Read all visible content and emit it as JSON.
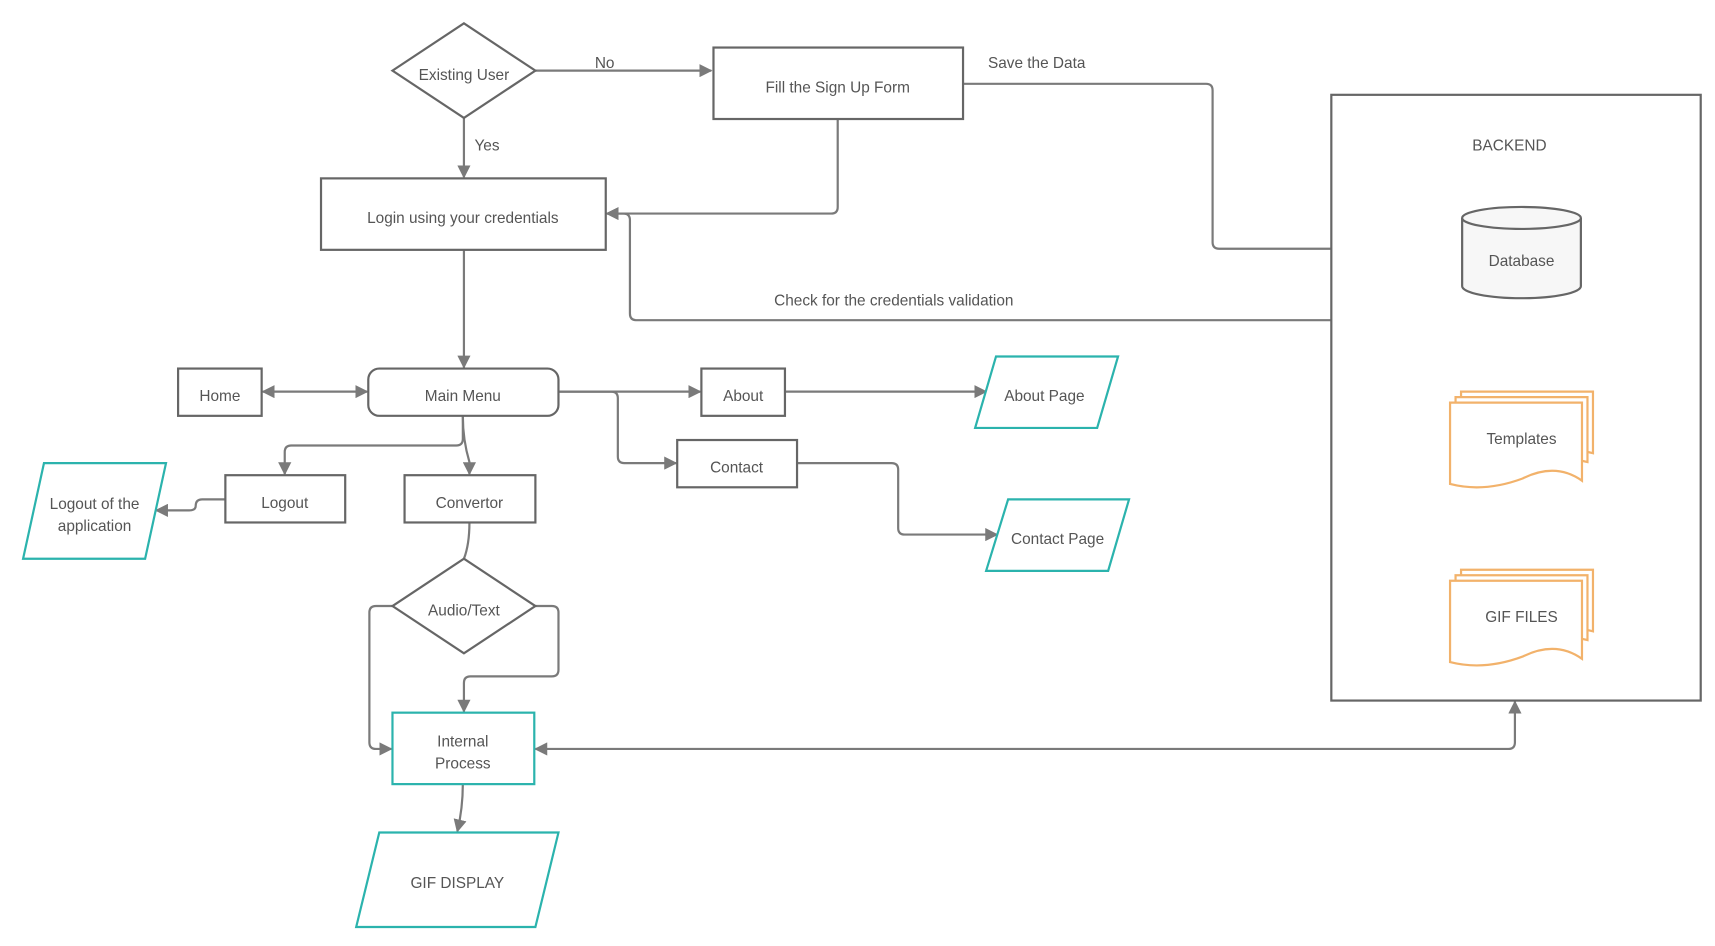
{
  "nodes": {
    "existing_user": "Existing User",
    "sign_up": "Fill the Sign Up Form",
    "login": "Login using your credentials",
    "main_menu": "Main Menu",
    "home": "Home",
    "about": "About",
    "about_page": "About Page",
    "contact": "Contact",
    "contact_page": "Contact Page",
    "logout": "Logout",
    "logout_app_1": "Logout of the",
    "logout_app_2": "application",
    "convertor": "Convertor",
    "audio_text": "Audio/Text",
    "internal_1": "Internal",
    "internal_2": "Process",
    "gif_display": "GIF DISPLAY",
    "backend": "BACKEND",
    "database": "Database",
    "templates": "Templates",
    "gif_files": "GIF FILES"
  },
  "edges": {
    "no": "No",
    "yes": "Yes",
    "save": "Save the Data",
    "check": "Check for the  credentials validation"
  },
  "colors": {
    "stroke": "#666666",
    "io": "#2bb3ad",
    "document": "#f2b26b",
    "edge": "#7a7a7a"
  }
}
